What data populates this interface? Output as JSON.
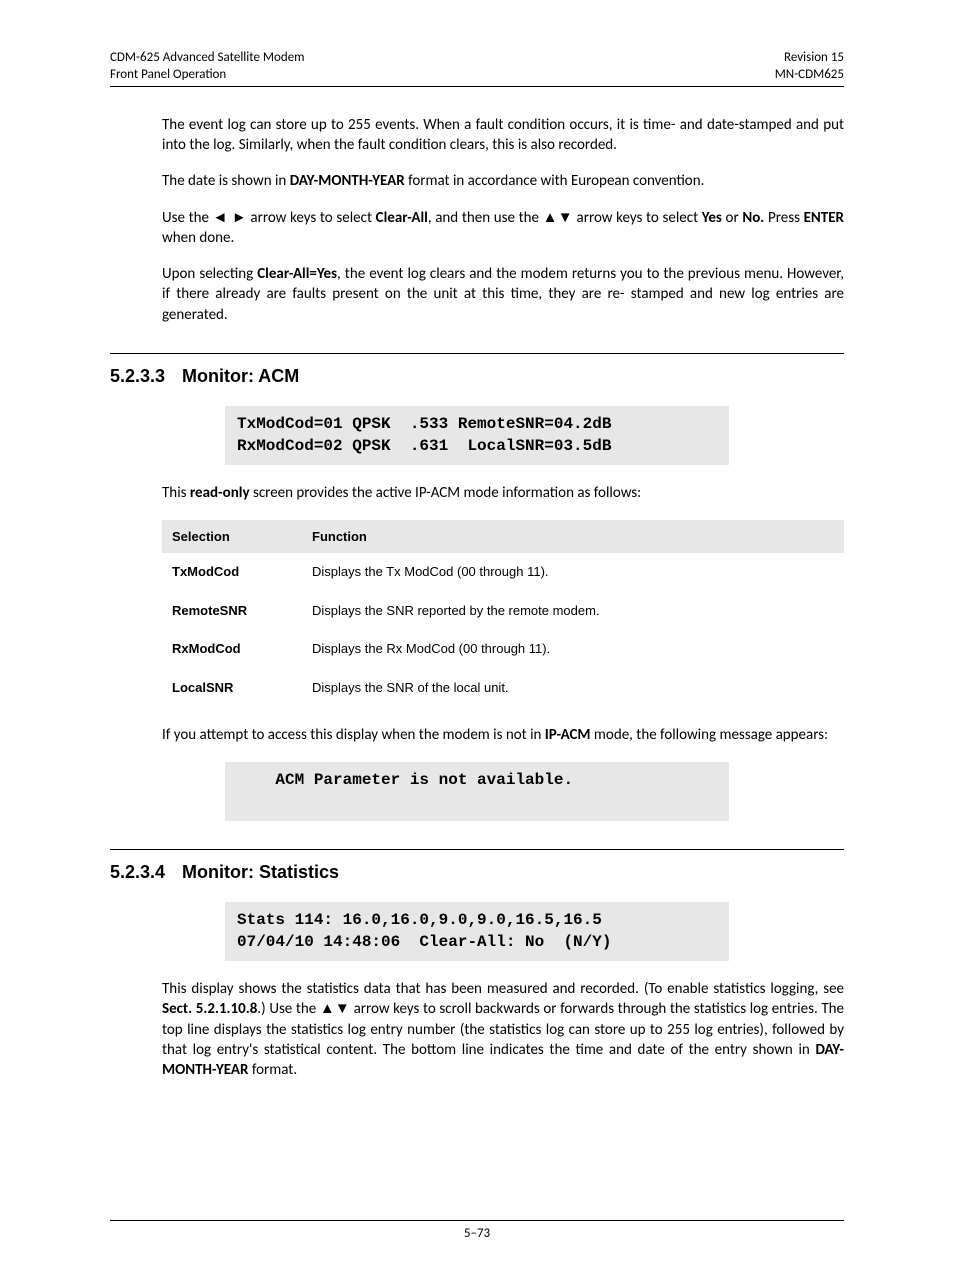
{
  "header": {
    "left_line1": "CDM-625 Advanced Satellite Modem",
    "left_line2": "Front Panel Operation",
    "right_line1": "Revision 15",
    "right_line2": "MN-CDM625"
  },
  "para1": "The event log can store up to 255 events. When a fault condition occurs, it is time- and date-stamped and put into the log. Similarly, when the fault condition clears, this is also recorded.",
  "para2_pre": "The date is shown in ",
  "para2_bold": "DAY-MONTH-YEAR",
  "para2_post": " format in accordance with European convention.",
  "para3_a": "Use the ",
  "para3_arrows_lr": "◄ ►",
  "para3_b": " arrow keys to select ",
  "para3_clear": "Clear-All",
  "para3_c": ", and then use the ",
  "para3_arrows_ud": "▲▼",
  "para3_d": " arrow keys to select ",
  "para3_yes": "Yes",
  "para3_e": " or ",
  "para3_no": "No.",
  "para3_f": " Press ",
  "para3_enter": "ENTER",
  "para3_g": " when done.",
  "para4_a": "Upon selecting ",
  "para4_bold": "Clear-All=Yes",
  "para4_b": ", the event log clears and the modem returns you to the previous menu. However, if there already are faults present on the unit at this time, they are re- stamped and new log entries are generated.",
  "section1": {
    "num": "5.2.3.3",
    "title": "Monitor: ACM"
  },
  "lcd1": "TxModCod=01 QPSK  .533 RemoteSNR=04.2dB\nRxModCod=02 QPSK  .631  LocalSNR=03.5dB",
  "para5_a": "This ",
  "para5_bold": "read-only",
  "para5_b": " screen provides the active IP-ACM mode information as follows:",
  "table": {
    "headers": [
      "Selection",
      "Function"
    ],
    "rows": [
      [
        "TxModCod",
        "Displays the Tx ModCod (00 through 11)."
      ],
      [
        "RemoteSNR",
        "Displays the SNR reported by the remote modem."
      ],
      [
        "RxModCod",
        "Displays the Rx ModCod (00 through 11)."
      ],
      [
        "LocalSNR",
        "Displays the SNR of the local unit."
      ]
    ]
  },
  "para6_a": "If you attempt to access this display when the modem is not in ",
  "para6_bold": "IP-ACM",
  "para6_b": " mode, the following message appears:",
  "lcd2": "    ACM Parameter is not available.\n ",
  "section2": {
    "num": "5.2.3.4",
    "title": "Monitor: Statistics"
  },
  "lcd3": "Stats 114: 16.0,16.0,9.0,9.0,16.5,16.5\n07/04/10 14:48:06  Clear-All: No  (N/Y)",
  "para7_a": "This display shows the statistics data that has been measured and recorded. (To enable statistics logging, see ",
  "para7_bold1": "Sect. 5.2.1.10.8",
  "para7_b": ".) Use the ",
  "para7_arrows": "▲▼",
  "para7_c": " arrow keys to scroll backwards or forwards through the statistics log entries. The top line displays the statistics log entry number (the statistics log can store up to 255 log entries), followed by that log entry's statistical content. The bottom line indicates the time and date of the entry shown in ",
  "para7_bold2": "DAY-MONTH-YEAR",
  "para7_d": " format.",
  "footer": "5–73"
}
